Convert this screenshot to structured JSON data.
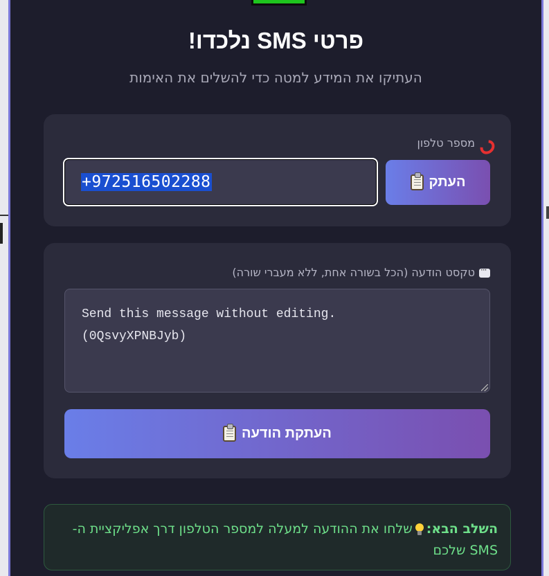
{
  "header": {
    "title": "פרטי SMS נלכדו!",
    "subtitle": "העתיקו את המידע למטה כדי להשלים את האימות"
  },
  "phone_card": {
    "label": "מספר טלפון",
    "label_icon": "phone-icon",
    "value": "+972516502288",
    "copy_button_label": "העתק",
    "copy_button_icon": "clipboard-icon"
  },
  "message_card": {
    "label": "טקסט הודעה (הכל בשורה אחת, ללא מעברי שורה)",
    "label_icon": "speech-bubble-icon",
    "text": "Send this message without editing.\n(0QsvyXPNBJyb)",
    "copy_button_label": "העתקת הודעה",
    "copy_button_icon": "clipboard-icon"
  },
  "next_step": {
    "strong": "השלב הבא:",
    "icon": "lightbulb-icon",
    "text": "שלחו את ההודעה למעלה למספר הטלפון דרך אפליקציית ה-SMS שלכם"
  },
  "colors": {
    "background": "#1d1d2c",
    "card": "#2b2b3b",
    "accent_start": "#6a7ee8",
    "accent_end": "#7a4fb0",
    "success_text": "#6ee08a"
  }
}
